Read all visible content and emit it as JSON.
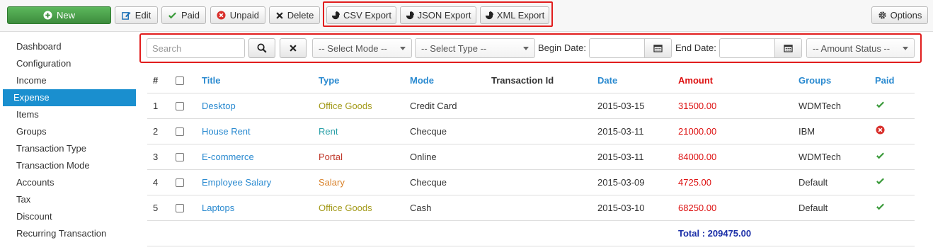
{
  "toolbar": {
    "new_label": "New",
    "edit_label": "Edit",
    "paid_label": "Paid",
    "unpaid_label": "Unpaid",
    "delete_label": "Delete",
    "csv_label": "CSV Export",
    "json_label": "JSON Export",
    "xml_label": "XML Export",
    "options_label": "Options"
  },
  "sidebar": {
    "items": [
      {
        "label": "Dashboard"
      },
      {
        "label": "Configuration"
      },
      {
        "label": "Income"
      },
      {
        "label": "Expense",
        "active": true
      },
      {
        "label": "Items"
      },
      {
        "label": "Groups"
      },
      {
        "label": "Transaction Type"
      },
      {
        "label": "Transaction Mode"
      },
      {
        "label": "Accounts"
      },
      {
        "label": "Tax"
      },
      {
        "label": "Discount"
      },
      {
        "label": "Recurring Transaction"
      }
    ]
  },
  "filters": {
    "search_placeholder": "Search",
    "mode_selected": "-- Select Mode --",
    "type_selected": "-- Select Type --",
    "begin_date_label": "Begin Date:",
    "end_date_label": "End Date:",
    "amount_status_selected": "-- Amount Status --"
  },
  "table": {
    "headers": {
      "num": "#",
      "title": "Title",
      "type": "Type",
      "mode": "Mode",
      "transaction_id": "Transaction Id",
      "date": "Date",
      "amount": "Amount",
      "groups": "Groups",
      "paid": "Paid"
    },
    "rows": [
      {
        "num": "1",
        "title": "Desktop",
        "type": "Office Goods",
        "type_color": "#a39a1a",
        "mode": "Credit Card",
        "transaction_id": "",
        "date": "2015-03-15",
        "amount": "31500.00",
        "groups": "WDMTech",
        "paid": true
      },
      {
        "num": "2",
        "title": "House Rent",
        "type": "Rent",
        "type_color": "#2aa0a8",
        "mode": "Checque",
        "transaction_id": "",
        "date": "2015-03-11",
        "amount": "21000.00",
        "groups": "IBM",
        "paid": false
      },
      {
        "num": "3",
        "title": "E-commerce",
        "type": "Portal",
        "type_color": "#c0392b",
        "mode": "Online",
        "transaction_id": "",
        "date": "2015-03-11",
        "amount": "84000.00",
        "groups": "WDMTech",
        "paid": true
      },
      {
        "num": "4",
        "title": "Employee Salary",
        "type": "Salary",
        "type_color": "#d9822b",
        "mode": "Checque",
        "transaction_id": "",
        "date": "2015-03-09",
        "amount": "4725.00",
        "groups": "Default",
        "paid": true
      },
      {
        "num": "5",
        "title": "Laptops",
        "type": "Office Goods",
        "type_color": "#a39a1a",
        "mode": "Cash",
        "transaction_id": "",
        "date": "2015-03-10",
        "amount": "68250.00",
        "groups": "Default",
        "paid": true
      }
    ],
    "total_label": "Total : 209475.00"
  },
  "colors": {
    "accent": "#1a8fcf",
    "link": "#2a8ad0",
    "amount": "#dd1111",
    "paid_ok": "#3a9a3a",
    "paid_no": "#d9302c",
    "highlight": "#e11d1d"
  }
}
